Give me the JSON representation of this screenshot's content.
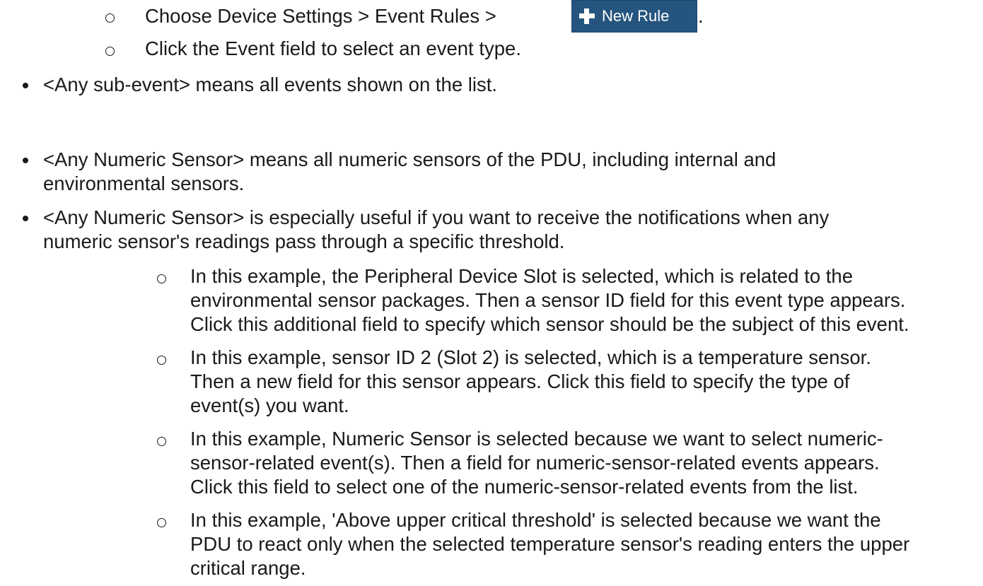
{
  "steps": {
    "choose_settings": "Choose Device Settings > Event Rules >",
    "period": ".",
    "click_event": "Click the Event field to select an event type."
  },
  "new_rule_button": {
    "label": "New Rule",
    "icon": "plus-icon"
  },
  "bullets": {
    "any_sub_event": "<Any sub-event> means all events shown on the list.",
    "any_numeric_1a": "<Any Numeric Sensor> means all numeric sensors of the PDU, including internal and",
    "any_numeric_1b": "environmental sensors.",
    "any_numeric_2a": "<Any Numeric Sensor> is especially useful if you want to receive the notifications when any",
    "any_numeric_2b": "numeric sensor's readings pass through a specific threshold."
  },
  "sub_bullets": {
    "ex1a": "In this example, the Peripheral Device Slot is selected, which is related to the",
    "ex1b": "environmental sensor packages. Then a sensor ID field for this event type appears.",
    "ex1c": "Click this additional field to specify which sensor should be the subject of this event.",
    "ex2a": "In this example, sensor ID 2 (Slot 2) is selected, which is a temperature sensor.",
    "ex2b": "Then a new field for this sensor appears. Click this field to specify the type of",
    "ex2c": "event(s) you want.",
    "ex3a": "In this example, Numeric Sensor is selected because we want to select numeric-",
    "ex3b": "sensor-related event(s). Then a field for numeric-sensor-related events appears.",
    "ex3c": "Click this field to select one of the numeric-sensor-related events from the list.",
    "ex4a": "In this example, 'Above upper critical threshold' is selected because we want the",
    "ex4b": "PDU to react only when the selected temperature sensor's reading enters the upper",
    "ex4c": "critical range."
  }
}
